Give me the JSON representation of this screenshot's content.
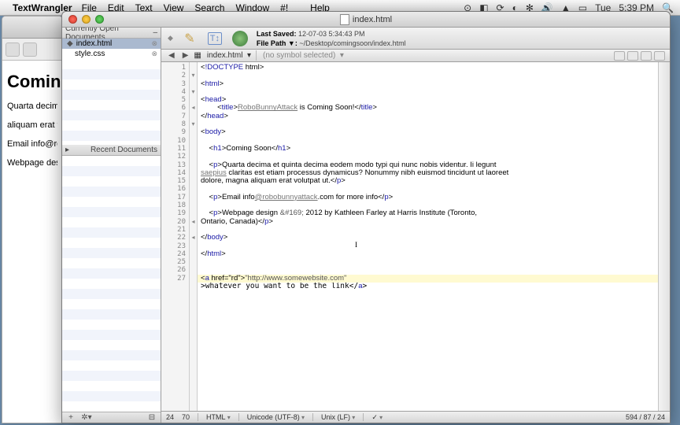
{
  "menubar": {
    "apple": "",
    "app": "TextWrangler",
    "items": [
      "File",
      "Edit",
      "Text",
      "View",
      "Search",
      "Window",
      "#!",
      "",
      "Help"
    ],
    "right_icons": [
      "⇪",
      "◧",
      "⟳",
      "◐",
      "✻",
      "🔊",
      "ᯤ",
      "🔋"
    ],
    "day": "Tue",
    "time": "5:39 PM",
    "search": "🔍"
  },
  "browser": {
    "h1": "Coming",
    "p1": "Quarta decima et",
    "p2": "aliquam erat volu",
    "p3": "Email info@robo",
    "p4": "Webpage design"
  },
  "tw": {
    "title_doc": "index.html",
    "sidebar": {
      "open_head": "Currently Open Documents",
      "items": [
        {
          "name": "index.html",
          "sel": true
        },
        {
          "name": "style.css",
          "sel": false
        }
      ],
      "recent_head": "Recent Documents"
    },
    "toolbar": {
      "saved_label": "Last Saved:",
      "saved_val": "12-07-03 5:34:43 PM",
      "path_label": "File Path ▼:",
      "path_val": "~/Desktop/comingsoon/index.html"
    },
    "nav": {
      "doc": "index.html",
      "symbol": "(no symbol selected)"
    },
    "code_lines": [
      "<!DOCTYPE html>",
      "",
      "<html>",
      "",
      "<head>",
      "        <title>RoboBunnyAttack is Coming Soon!</title>",
      "</head>",
      "",
      "<body>",
      "",
      "    <h1>Coming Soon</h1>",
      "",
      "    <p>Quarta decima et quinta decima eodem modo typi qui nunc nobis videntur. Ii legunt",
      "saepius claritas est etiam processus dynamicus? Nonummy nibh euismod tincidunt ut laoreet",
      "dolore, magna aliquam erat volutpat ut.</p>",
      "",
      "    <p>Email info@robobunnyattack.com for more info</p>",
      "",
      "    <p>Webpage design &#169; 2012 by Kathleen Farley at Harris Institute (Toronto,",
      "Ontario, Canada)</p>",
      "",
      "</body>",
      "",
      "</html>",
      "",
      "",
      "<a href=\"http://www.somewebsite.com\">whatever you want to be the link</a>"
    ],
    "fold_markers": {
      "2": "▾",
      "4": "▾",
      "6": "◂",
      "8": "▾",
      "20": "◂",
      "22": "◂"
    },
    "status": {
      "line": "24",
      "col": "70",
      "lang": "HTML",
      "enc": "Unicode (UTF-8)",
      "le": "Unix (LF)",
      "size": "594 / 87 / 24"
    }
  }
}
